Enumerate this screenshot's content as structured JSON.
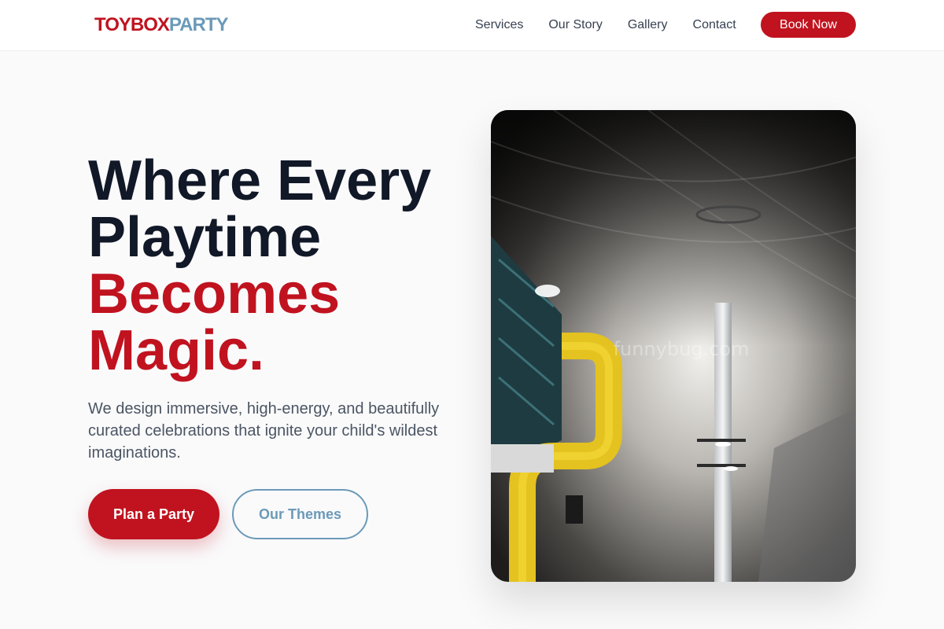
{
  "brand": {
    "part1": "TOYBOX",
    "part2": "PARTY",
    "accent_color": "#c0131f",
    "secondary_color": "#6b9ab8"
  },
  "nav": {
    "links": [
      "Services",
      "Our Story",
      "Gallery",
      "Contact"
    ],
    "cta": "Book Now"
  },
  "hero": {
    "title_lines": [
      "Where Every",
      "Playtime"
    ],
    "title_accent_lines": [
      "Becomes",
      "Magic."
    ],
    "subtitle": "We design immersive, high-energy, and beautifully curated celebrations that ignite your child's wildest imaginations.",
    "primary_button": "Plan a Party",
    "secondary_button": "Our Themes",
    "image_watermark": "funnybug.com"
  }
}
